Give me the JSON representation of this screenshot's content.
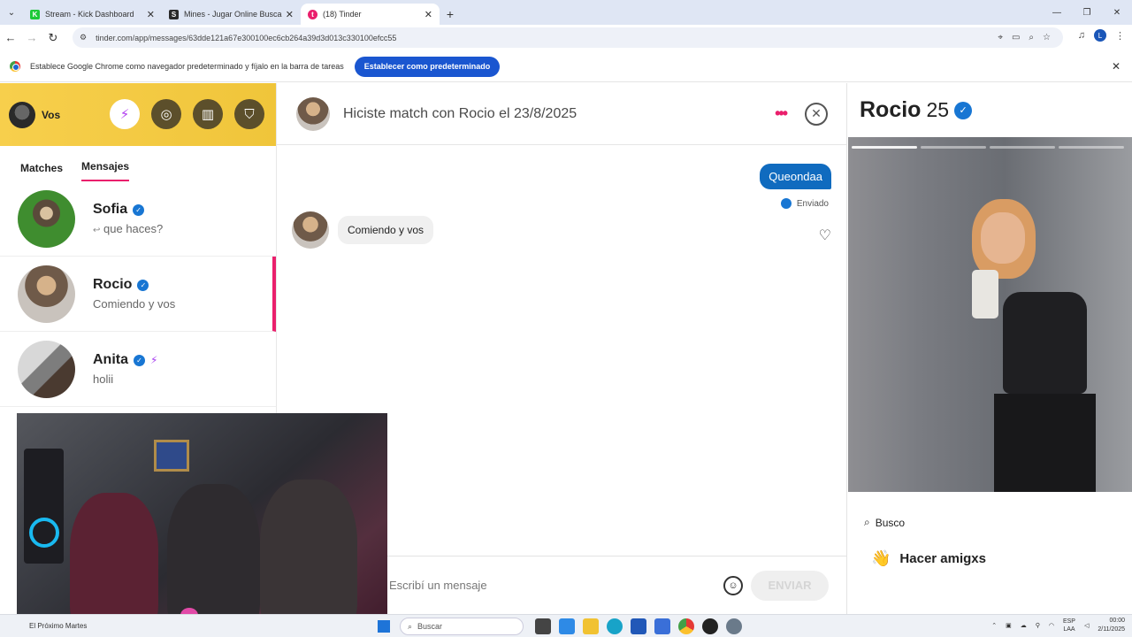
{
  "browser": {
    "tabs": [
      {
        "title": "Stream - Kick Dashboard",
        "favicon_color": "#1dc937",
        "favicon_letter": "K"
      },
      {
        "title": "Mines - Jugar Online Buscamin",
        "favicon_color": "#2a2a2a",
        "favicon_letter": "S"
      },
      {
        "title": "(18) Tinder",
        "favicon_color": "#ea1f6c",
        "favicon_letter": "t",
        "active": true
      }
    ],
    "url": "tinder.com/app/messages/63dde121a67e300100ec6cb264a39d3d013c330100efcc55",
    "profile_initial": "L"
  },
  "infobar": {
    "text": "Establece Google Chrome como navegador predeterminado y fíjalo en la barra de tareas",
    "button": "Establecer como predeterminado"
  },
  "sidebar": {
    "user": "Vos",
    "tabs": {
      "matches": "Matches",
      "messages": "Mensajes"
    },
    "conversations": [
      {
        "name": "Sofia",
        "message": "que haces?",
        "reply_icon": "↩",
        "avatar_color": "#3f8d2f"
      },
      {
        "name": "Rocio",
        "message": "Comiendo y vos",
        "avatar_color": "#6f5a49",
        "selected": true
      },
      {
        "name": "Anita",
        "message": "holii",
        "avatar_color": "#8a8a8a",
        "boost": true
      }
    ]
  },
  "chat": {
    "title": "Hiciste match con Rocio el 23/8/2025",
    "outgoing": "Queondaa",
    "sent_status": "Enviado",
    "incoming": "Comiendo y vos",
    "composer_placeholder": "Escribí un mensaje",
    "send_label": "ENVIAR"
  },
  "profile": {
    "name": "Rocio",
    "age": "25",
    "looking_label": "Busco",
    "goal": "Hacer amigxs"
  },
  "taskbar": {
    "left_label": "El Próximo Martes",
    "search_placeholder": "Buscar",
    "lang_top": "ESP",
    "lang_bottom": "LAA",
    "time": "00:00",
    "date": "2/11/2025"
  },
  "colors": {
    "tinder_pink": "#ea1f6c",
    "verified_blue": "#1876d3",
    "outgoing_bubble": "#106bbf",
    "header_yellow": "#f2c83c"
  }
}
